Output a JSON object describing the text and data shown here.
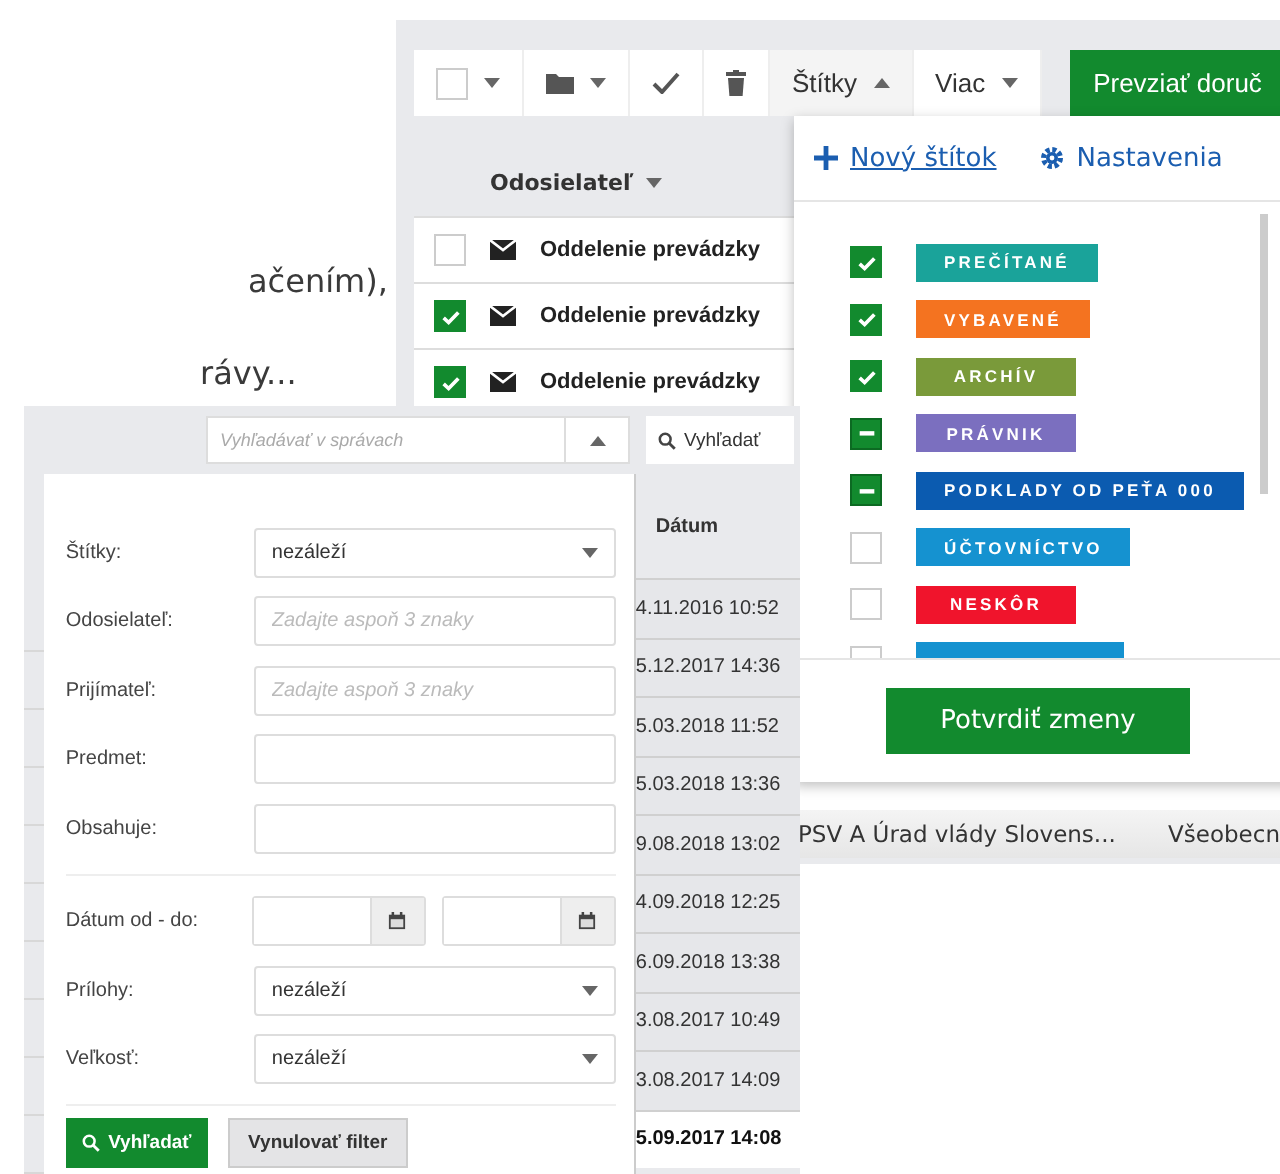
{
  "background_text": [
    "ačením),",
    "rávy..."
  ],
  "mail_window": {
    "toolbar": {
      "select_all": {
        "checked": false
      },
      "labels_button": {
        "label": "Štítky",
        "expanded": true
      },
      "more_button": {
        "label": "Viac",
        "expanded": false
      },
      "accept_button": {
        "label": "Prevziať doruč"
      }
    },
    "sender_header": "Odosielateľ",
    "rows": [
      {
        "sender": "Oddelenie prevádzky",
        "checked": false
      },
      {
        "sender": "Oddelenie prevádzky",
        "checked": true
      },
      {
        "sender": "Oddelenie prevádzky",
        "checked": true
      }
    ]
  },
  "labels_dropdown": {
    "new_label": "Nový štítok",
    "settings": "Nastavenia",
    "labels": [
      {
        "label": "PREČÍTANÉ",
        "color": "#1aa39a",
        "checked": true,
        "mixed": false
      },
      {
        "label": "VYBAVENÉ",
        "color": "#f47320",
        "checked": true,
        "mixed": false
      },
      {
        "label": "ARCHÍV",
        "color": "#7a9a3a",
        "checked": true,
        "mixed": false
      },
      {
        "label": "PRÁVNIK",
        "color": "#7b6fbf",
        "checked": false,
        "mixed": true
      },
      {
        "label": "PODKLADY OD PEŤA 000",
        "color": "#0b5bb0",
        "checked": false,
        "mixed": true
      },
      {
        "label": "ÚČTOVNÍCTVO",
        "color": "#1592d0",
        "checked": false,
        "mixed": false
      },
      {
        "label": "NESKÔR",
        "color": "#f0142c",
        "checked": false,
        "mixed": false
      },
      {
        "color": "#1592d0",
        "checked": false,
        "mixed": false
      }
    ],
    "confirm_button": "Potvrdiť zmeny"
  },
  "message_row": {
    "column_1": "PSV A Úrad vlády Slovens...",
    "column_2": "Všeobecn"
  },
  "search_window": {
    "search": {
      "placeholder": "Vyhľadávať v správach"
    },
    "search_button": "Vyhľadať",
    "date_header": "Dátum",
    "dates": [
      {
        "text": "4.11.2016 10:52",
        "unread": false
      },
      {
        "text": "5.12.2017 14:36",
        "unread": false
      },
      {
        "text": "5.03.2018 11:52",
        "unread": false
      },
      {
        "text": "5.03.2018 13:36",
        "unread": false
      },
      {
        "text": "9.08.2018 13:02",
        "unread": false
      },
      {
        "text": "4.09.2018 12:25",
        "unread": false
      },
      {
        "text": "6.09.2018 13:38",
        "unread": false
      },
      {
        "text": "3.08.2017 10:49",
        "unread": false
      },
      {
        "text": "3.08.2017 14:09",
        "unread": false
      },
      {
        "text": "5.09.2017 14:08",
        "unread": true
      }
    ],
    "filter": {
      "sections": [
        {
          "fields": [
            {
              "kind": "select",
              "label": "Štítky:",
              "value": "nezáleží"
            },
            {
              "kind": "text",
              "label": "Odosielateľ:",
              "placeholder": "Zadajte aspoň 3 znaky"
            },
            {
              "kind": "text",
              "label": "Prijímateľ:",
              "placeholder": "Zadajte aspoň 3 znaky"
            },
            {
              "kind": "text",
              "label": "Predmet:"
            },
            {
              "kind": "text",
              "label": "Obsahuje:"
            }
          ]
        },
        {
          "fields": [
            {
              "kind": "daterange",
              "label": "Dátum od - do:"
            },
            {
              "kind": "select",
              "label": "Prílohy:",
              "value": "nezáleží"
            },
            {
              "kind": "select",
              "label": "Veľkosť:",
              "value": "nezáleží"
            }
          ]
        }
      ],
      "search_button": "Vyhľadať",
      "reset_button": "Vynulovať filter"
    }
  }
}
